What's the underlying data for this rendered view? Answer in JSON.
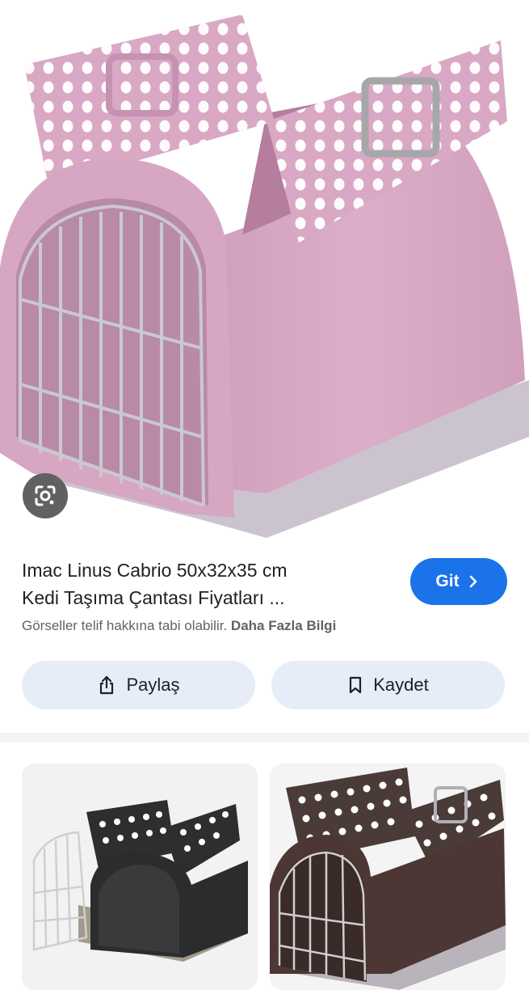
{
  "result": {
    "title_line1": "Imac Linus Cabrio 50x32x35 cm",
    "title_line2": "Kedi Taşıma Çantası Fiyatları ...",
    "visit_label": "Git",
    "copyright_notice": "Görseller telif hakkına tabi olabilir.",
    "more_info_link": "Daha Fazla Bilgi"
  },
  "actions": {
    "share_label": "Paylaş",
    "save_label": "Kaydet"
  },
  "icons": {
    "lens": "google-lens-icon",
    "visit": "chevron-right-icon",
    "share": "share-icon",
    "save": "bookmark-icon"
  },
  "colors": {
    "accent": "#1a73e8",
    "carrier_main": "#d7a9c4",
    "carrier_dark": "#c793b2",
    "carrier_base": "#cfc8d2"
  }
}
